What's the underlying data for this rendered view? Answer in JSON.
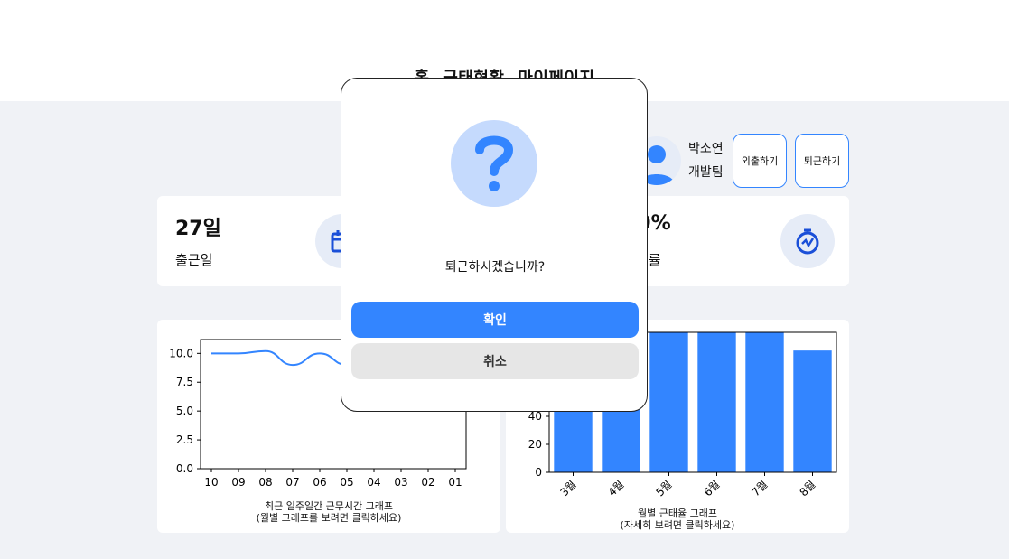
{
  "nav": {
    "items": [
      "홈",
      "근태현황",
      "마이페이지"
    ]
  },
  "profile": {
    "name": "박소연",
    "team": "개발팀",
    "outing_label": "외출하기",
    "leave_label": "퇴근하기"
  },
  "stats": [
    {
      "value": "27일",
      "label": "출근일",
      "icon": "calendar-icon"
    },
    {
      "value": "90%",
      "label": "출석률",
      "icon": "stopwatch-icon"
    }
  ],
  "line_chart": {
    "caption_line1": "최근 일주일간 근무시간 그래프",
    "caption_line2": "(월별 그래프를 보려면 클릭하세요)"
  },
  "bar_chart": {
    "caption_line1": "월별 근태율 그래프",
    "caption_line2": "(자세히 보려면 클릭하세요)"
  },
  "chart_data": [
    {
      "type": "line",
      "x": [
        "10",
        "09",
        "08",
        "07",
        "06",
        "05",
        "04",
        "03",
        "02",
        "01"
      ],
      "series": [
        {
          "values": [
            10.0,
            10.0,
            10.2,
            9.0,
            10.0,
            9.0,
            null,
            null,
            null,
            null
          ]
        }
      ],
      "yticks": [
        "0.0",
        "2.5",
        "5.0",
        "7.5",
        "10.0"
      ],
      "ylim": [
        0,
        11.2
      ],
      "color": "#3385ff"
    },
    {
      "type": "bar",
      "categories": [
        "3월",
        "4월",
        "5월",
        "6월",
        "7월",
        "8월"
      ],
      "values": [
        100,
        100,
        100,
        100,
        100,
        87
      ],
      "yticks": [
        "0",
        "20",
        "40"
      ],
      "ylim": [
        0,
        100
      ],
      "color": "#3385ff"
    }
  ],
  "modal": {
    "icon": "question-icon",
    "message": "퇴근하시겠습니까?",
    "confirm_label": "확인",
    "cancel_label": "취소",
    "accent": "#3385ff"
  }
}
